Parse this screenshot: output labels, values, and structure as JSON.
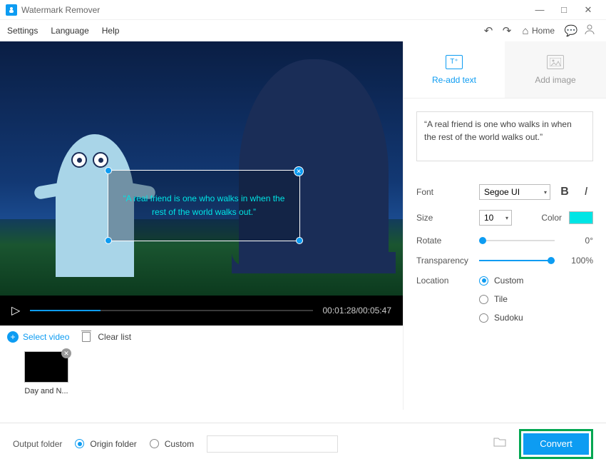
{
  "app": {
    "title": "Watermark Remover"
  },
  "menu": {
    "settings": "Settings",
    "language": "Language",
    "help": "Help",
    "home": "Home"
  },
  "tabs": {
    "readd_text": "Re-add text",
    "add_image": "Add image"
  },
  "watermark_text": "“A real friend is one who walks in when the rest of the world walks out.”",
  "preview_text": "“A real friend is one who walks in when the rest of the world walks out.”",
  "controls": {
    "font_label": "Font",
    "font_value": "Segoe UI",
    "size_label": "Size",
    "size_value": "10",
    "color_label": "Color",
    "color_value": "#00e5e5",
    "rotate_label": "Rotate",
    "rotate_value": "0°",
    "transparency_label": "Transparency",
    "transparency_value": "100%",
    "location_label": "Location",
    "location_options": {
      "custom": "Custom",
      "tile": "Tile",
      "sudoku": "Sudoku"
    }
  },
  "playback": {
    "current": "00:01:28",
    "total": "00:05:47"
  },
  "cliplist": {
    "select_video": "Select video",
    "clear_list": "Clear list"
  },
  "clips": [
    {
      "name": "Day and N..."
    }
  ],
  "footer": {
    "output_label": "Output folder",
    "origin_label": "Origin folder",
    "custom_label": "Custom",
    "convert": "Convert"
  }
}
